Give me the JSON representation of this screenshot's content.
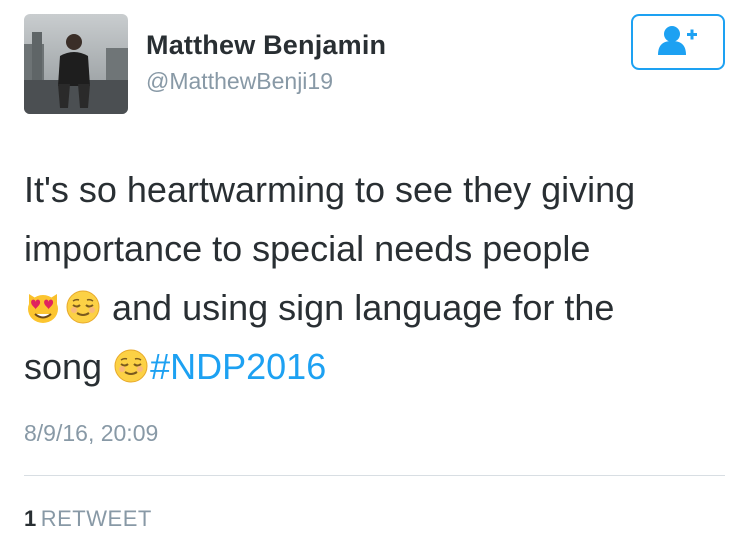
{
  "author": {
    "name": "Matthew Benjamin",
    "handle": "@MatthewBenji19"
  },
  "tweet": {
    "line1": "It's so heartwarming to see they giving",
    "line2": "importance to special needs people",
    "line3": "and using sign language for the",
    "line4": "song",
    "hashtag": "#NDP2016"
  },
  "timestamp": "8/9/16, 20:09",
  "stats": {
    "retweet_count": "1",
    "retweet_label": "RETWEET"
  },
  "icons": [
    "follow-add-user-icon",
    "heart-eyes-cat-emoji",
    "relieved-face-emoji"
  ],
  "colors": {
    "accent": "#1da1f2",
    "text": "#292f33",
    "muted": "#8899a6"
  }
}
